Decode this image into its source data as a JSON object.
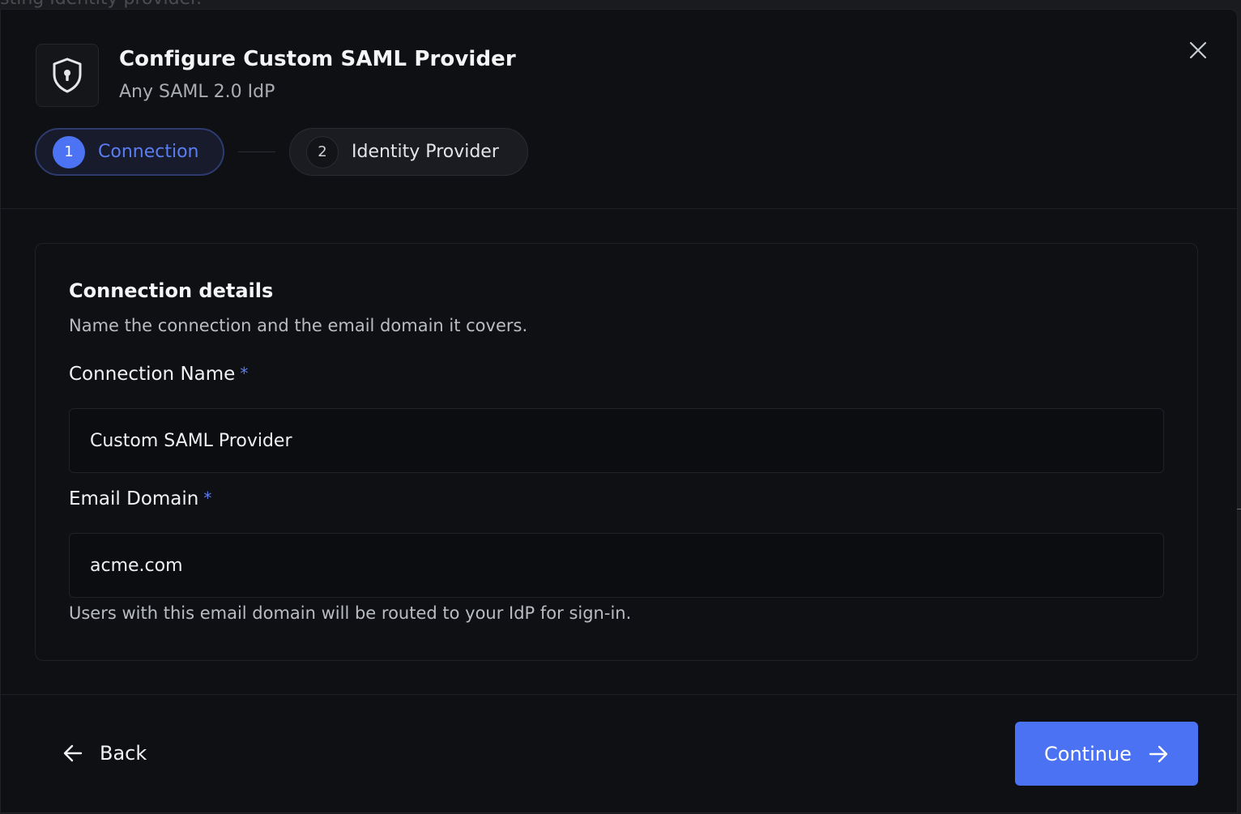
{
  "backdrop": {
    "text": "isting Identity provider."
  },
  "dialog": {
    "title": "Configure Custom SAML Provider",
    "subtitle": "Any SAML 2.0 IdP",
    "icons": {
      "logo": "shield-keyhole-icon",
      "close": "close-icon"
    }
  },
  "steps": [
    {
      "number": "1",
      "label": "Connection",
      "state": "active"
    },
    {
      "number": "2",
      "label": "Identity Provider",
      "state": "upcoming"
    }
  ],
  "card": {
    "title": "Connection details",
    "description": "Name the connection and the email domain it covers.",
    "fields": [
      {
        "label": "Connection Name",
        "required_mark": "*",
        "value": "Custom SAML Provider"
      },
      {
        "label": "Email Domain",
        "required_mark": "*",
        "value": "acme.com"
      }
    ],
    "hint": "Users with this email domain will be routed to your IdP for sign-in."
  },
  "footer": {
    "back_label": "Back",
    "continue_label": "Continue",
    "icons": {
      "back": "arrow-left-icon",
      "continue": "arrow-right-icon"
    }
  },
  "colors": {
    "accent": "#4a72f3",
    "background": "#0f1013",
    "active_step_text": "#5a7df2"
  }
}
